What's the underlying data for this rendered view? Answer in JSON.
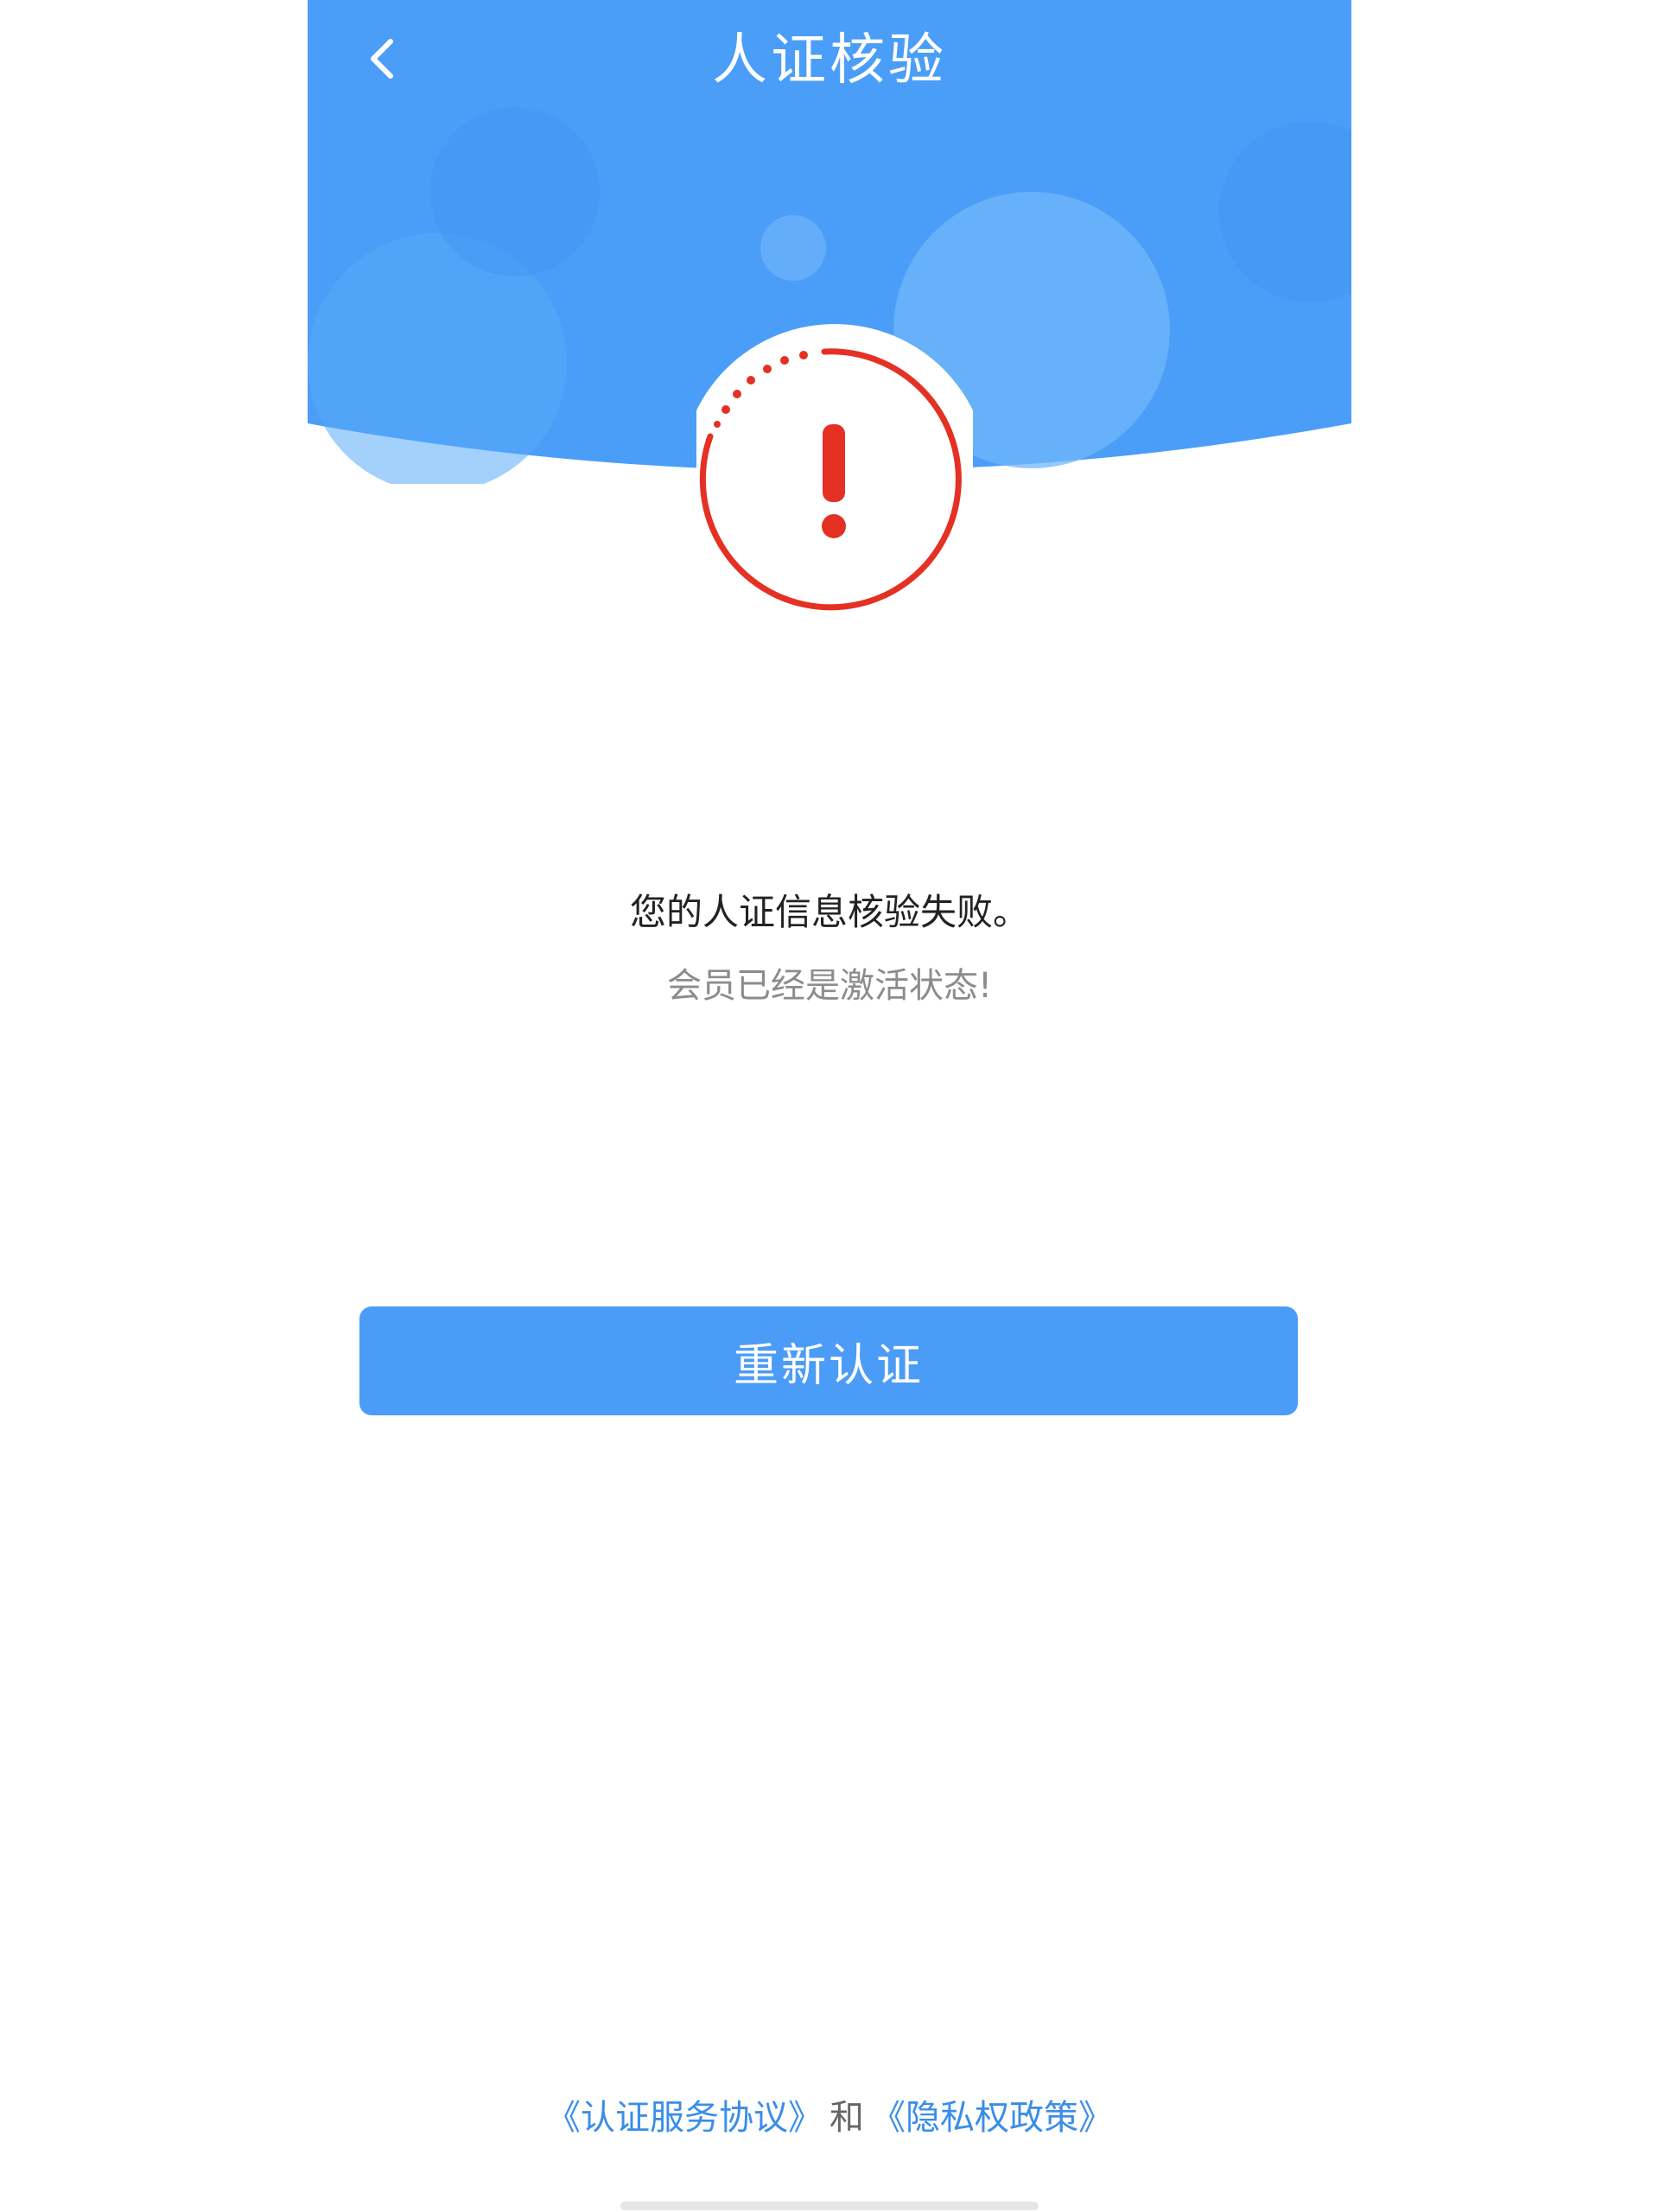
{
  "nav": {
    "title": "人证核验",
    "back_icon": "chevron-left-icon"
  },
  "status": {
    "icon": "exclamation-alert-icon",
    "color": "#e53024"
  },
  "result": {
    "message": "您的人证信息核验失败。",
    "detail": "会员已经是激活状态!"
  },
  "actions": {
    "retry_label": "重新认证"
  },
  "footer": {
    "agreement_link": "《认证服务协议》",
    "joiner": "和",
    "privacy_link": "《隐私权政策》"
  },
  "colors": {
    "header_blue": "#4a9ef8",
    "button_blue": "#4b9cf6",
    "link_blue": "#3a8de8",
    "alert_red": "#e53024"
  }
}
